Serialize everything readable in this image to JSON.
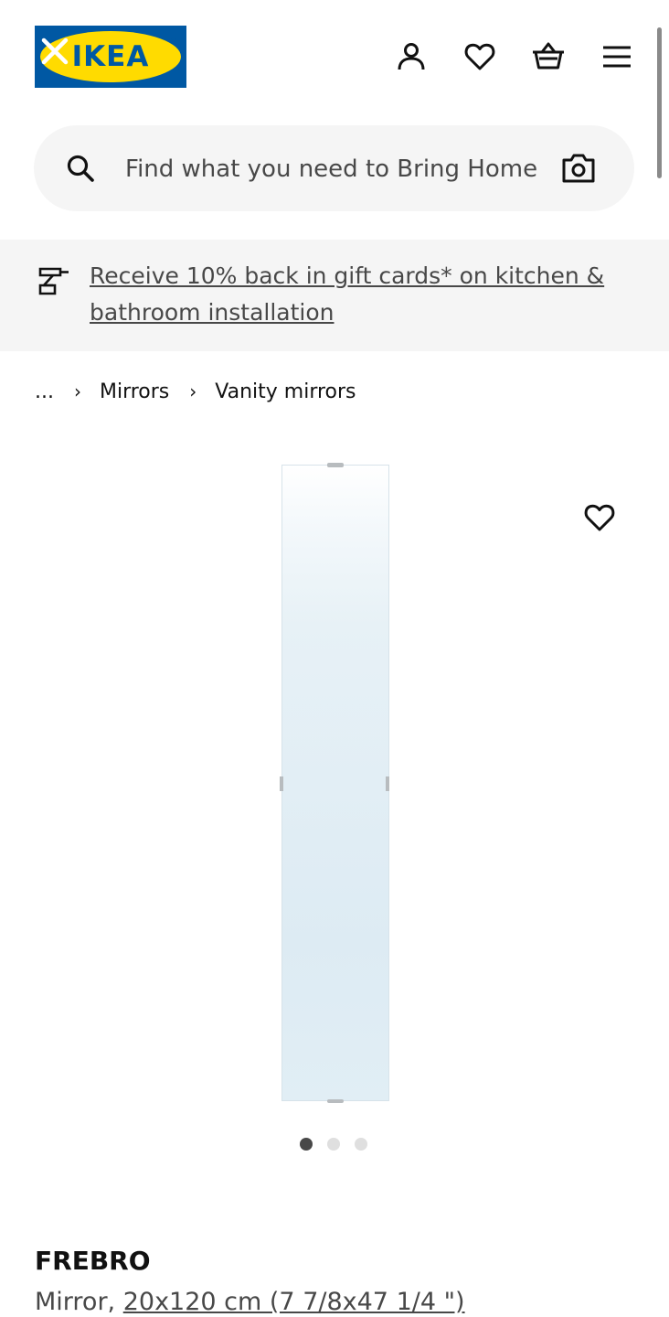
{
  "header": {
    "logo_text": "IKEA",
    "logo_reg": "®",
    "icons": [
      "close-icon",
      "user-icon",
      "heart-icon",
      "basket-icon",
      "menu-icon"
    ]
  },
  "search": {
    "placeholder": "Find what you need to Bring Home"
  },
  "promo": {
    "text": "Receive 10% back in gift cards* on kitchen & bathroom installation"
  },
  "breadcrumb": {
    "ellipsis": "...",
    "items": [
      "Mirrors",
      "Vanity mirrors"
    ],
    "separator": "›"
  },
  "gallery": {
    "slide_count": 3,
    "active_index": 0
  },
  "product": {
    "name": "FREBRO",
    "type": "Mirror, ",
    "size": "20x120 cm (7 7/8x47 1/4 \")"
  },
  "colors": {
    "ikea_blue": "#0058a3",
    "ikea_yellow": "#ffdb00",
    "text_dark": "#111111",
    "text_gray": "#484848",
    "panel_gray": "#f5f5f5"
  }
}
